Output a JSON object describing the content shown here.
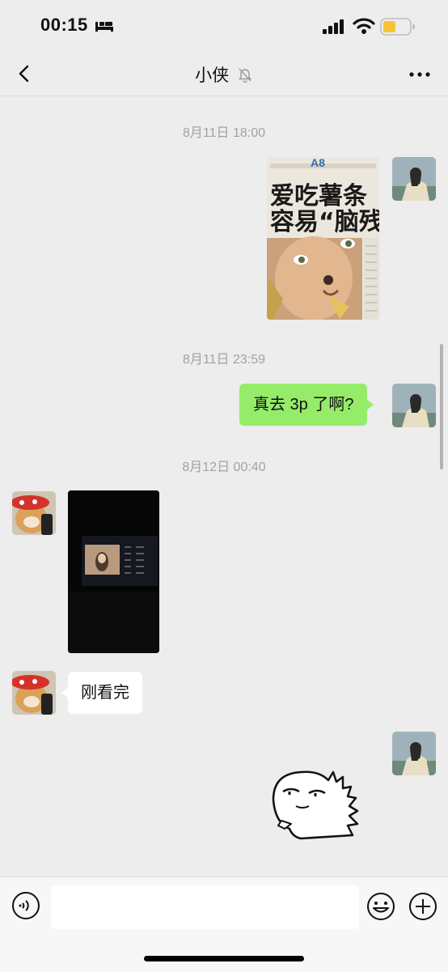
{
  "status_bar": {
    "time": "00:15",
    "battery_color": "#f5c332"
  },
  "header": {
    "title": "小侠",
    "back_icon": "chevron-left-icon",
    "mute_icon": "bell-slash-icon",
    "more_icon": "ellipsis-icon"
  },
  "messages": {
    "ts1": "8月11日 18:00",
    "ts2": "8月11日 23:59",
    "out_text": "真去 3p 了啊?",
    "ts3": "8月12日 00:40",
    "in_text": "刚看完",
    "news_image": {
      "tag": "A8",
      "headline_line1": "爱吃薯条",
      "headline_line2": "容易“脑残"
    }
  },
  "input_bar": {
    "placeholder": "",
    "voice_icon": "voice-icon",
    "emoji_icon": "emoji-icon",
    "plus_icon": "plus-icon"
  },
  "colors": {
    "background": "#ededed",
    "outgoing_bubble": "#95ec69",
    "incoming_bubble": "#ffffff",
    "timestamp": "#a2a2a2"
  }
}
